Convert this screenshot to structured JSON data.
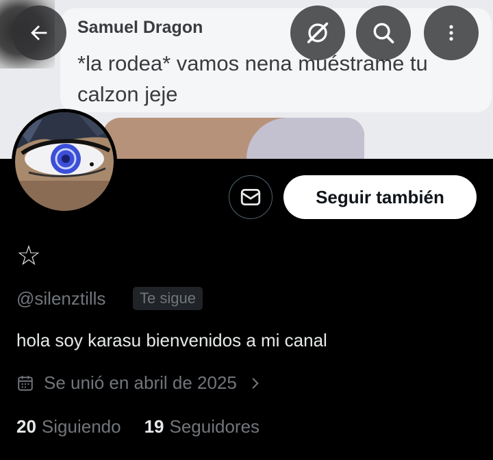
{
  "banner": {
    "author": "Samuel Dragon",
    "message": "*la rodea* vamos nena muéstrame tu calzon jeje"
  },
  "toolbar": {
    "back_icon": "arrow-left-icon",
    "grok_icon": "grok-icon",
    "search_icon": "search-icon",
    "more_icon": "more-vertical-icon"
  },
  "profile": {
    "name_glyph": "☆",
    "handle": "@silenztills",
    "follows_you": "Te sigue",
    "bio": "hola soy karasu bienvenidos a mi canal",
    "joined": "Se unió en abril de 2025",
    "following_count": "20",
    "following_label": "Siguiendo",
    "followers_count": "19",
    "followers_label": "Seguidores"
  },
  "actions": {
    "message_icon": "envelope-icon",
    "follow_label": "Seguir también"
  },
  "colors": {
    "background": "#000000",
    "text_primary": "#e7e9ea",
    "text_secondary": "#71767b",
    "button_bg": "#ffffff",
    "avatar_eye": "#3b4fd8"
  }
}
